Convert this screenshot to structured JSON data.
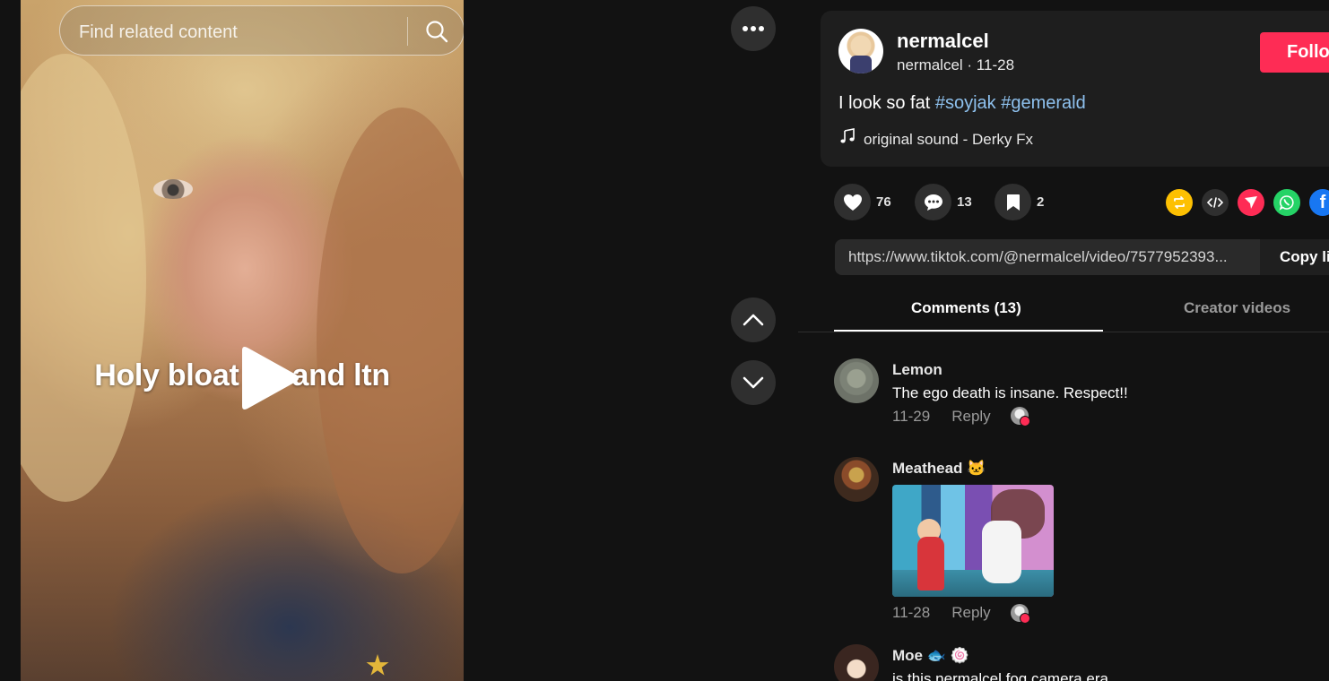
{
  "search": {
    "placeholder": "Find related content"
  },
  "video": {
    "caption": "Holy bloat     ltb and ltn"
  },
  "post": {
    "author_name": "nermalcel",
    "author_sub": "nermalcel · 11-28",
    "follow_label": "Follow",
    "desc_text": "I look so fat ",
    "hashtags": [
      "#soyjak",
      "#gemerald"
    ],
    "music": "original sound - Derky Fx"
  },
  "actions": {
    "likes": "76",
    "comments": "13",
    "saves": "2"
  },
  "link": {
    "url": "https://www.tiktok.com/@nermalcel/video/7577952393...",
    "copy_label": "Copy link"
  },
  "tabs": {
    "comments": "Comments (13)",
    "creator_videos": "Creator videos"
  },
  "comments": [
    {
      "name": "Lemon",
      "text": "The ego death is insane. Respect!!",
      "date": "11-29",
      "reply": "Reply"
    },
    {
      "name": "Meathead 🐱",
      "text": "",
      "date": "11-28",
      "reply": "Reply"
    },
    {
      "name": "Moe 🐟 🍥",
      "text": "is this nermalcel fog camera era",
      "date": "",
      "reply": "Reply"
    }
  ],
  "colors": {
    "accent": "#fe2c55",
    "hashtag": "#8ec1ee",
    "background": "#121212"
  }
}
